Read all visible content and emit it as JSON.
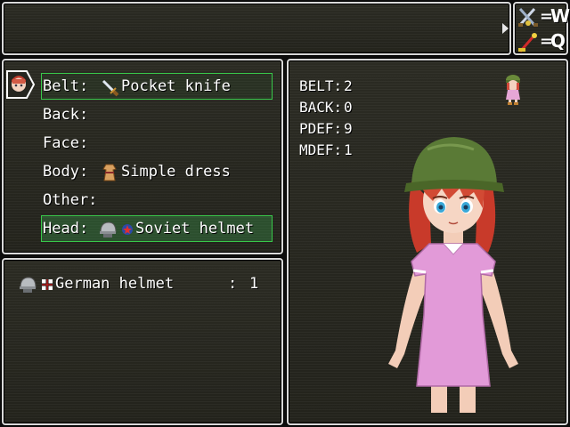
{
  "help_window": {
    "text": ""
  },
  "hotkeys": [
    {
      "key": "W",
      "icon": "sword-icon"
    },
    {
      "key": "Q",
      "icon": "wand-icon"
    }
  ],
  "slots": [
    {
      "label": "Belt:",
      "item": "Pocket knife",
      "icon": "knife-icon"
    },
    {
      "label": "Back:",
      "item": ""
    },
    {
      "label": "Face:",
      "item": ""
    },
    {
      "label": "Body:",
      "item": "Simple dress",
      "icon": "dress-icon"
    },
    {
      "label": "Other:",
      "item": ""
    },
    {
      "label": "Head:",
      "item": "Soviet helmet",
      "icon": "helmet-icon",
      "flag_icon": "soviet-flag-icon"
    }
  ],
  "inventory": [
    {
      "name": "German helmet",
      "sep": ":",
      "count": "1",
      "icon": "helmet-icon",
      "flag_icon": "german-cross-icon"
    }
  ],
  "stats": [
    {
      "label": "BELT:",
      "value": "2"
    },
    {
      "label": "BACK:",
      "value": "0"
    },
    {
      "label": "PDEF:",
      "value": "9"
    },
    {
      "label": "MDEF:",
      "value": "1"
    }
  ],
  "colors": {
    "selection": "#38c84a",
    "border": "#d8d8d8",
    "window_bg": "#262620"
  }
}
